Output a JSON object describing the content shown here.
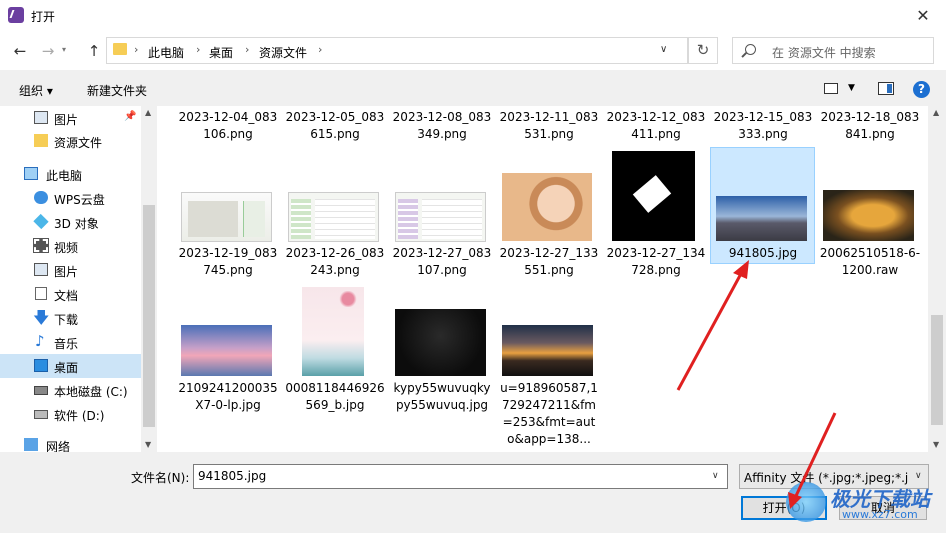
{
  "window": {
    "title": "打开",
    "close_symbol": "✕"
  },
  "nav": {
    "back_symbol": "←",
    "forward_symbol": "→",
    "up_symbol": "↑",
    "breadcrumbs": [
      "此电脑",
      "桌面",
      "资源文件"
    ],
    "search_placeholder": "在 资源文件 中搜索"
  },
  "toolbar": {
    "organize": "组织 ▾",
    "new_folder": "新建文件夹",
    "help": "?"
  },
  "sidebar": {
    "items": [
      {
        "label": "图片",
        "icon": "picture-icon"
      },
      {
        "label": "资源文件",
        "icon": "folder-icon"
      },
      {
        "label": "此电脑",
        "icon": "computer-icon"
      },
      {
        "label": "WPS云盘",
        "icon": "cloud-icon"
      },
      {
        "label": "3D 对象",
        "icon": "cube-icon"
      },
      {
        "label": "视频",
        "icon": "video-icon"
      },
      {
        "label": "图片",
        "icon": "picture-icon"
      },
      {
        "label": "文档",
        "icon": "document-icon"
      },
      {
        "label": "下载",
        "icon": "download-icon"
      },
      {
        "label": "音乐",
        "icon": "music-icon"
      },
      {
        "label": "桌面",
        "icon": "desktop-icon"
      },
      {
        "label": "本地磁盘 (C:)",
        "icon": "drive-icon"
      },
      {
        "label": "软件 (D:)",
        "icon": "drive-icon"
      },
      {
        "label": "网络",
        "icon": "network-icon"
      }
    ]
  },
  "files": {
    "row0": [
      {
        "l1": "2023-12-04_083",
        "l2": "106.png"
      },
      {
        "l1": "2023-12-05_083",
        "l2": "615.png"
      },
      {
        "l1": "2023-12-08_083",
        "l2": "349.png"
      },
      {
        "l1": "2023-12-11_083",
        "l2": "531.png"
      },
      {
        "l1": "2023-12-12_083",
        "l2": "411.png"
      },
      {
        "l1": "2023-12-15_083",
        "l2": "333.png"
      },
      {
        "l1": "2023-12-18_083",
        "l2": "841.png"
      }
    ],
    "row1": [
      {
        "l1": "2023-12-19_083",
        "l2": "745.png"
      },
      {
        "l1": "2023-12-26_083",
        "l2": "243.png"
      },
      {
        "l1": "2023-12-27_083",
        "l2": "107.png"
      },
      {
        "l1": "2023-12-27_133",
        "l2": "551.png"
      },
      {
        "l1": "2023-12-27_134",
        "l2": "728.png"
      },
      {
        "l1": "941805.jpg",
        "l2": ""
      },
      {
        "l1": "20062510518-6-",
        "l2": "1200.raw"
      }
    ],
    "row2": [
      {
        "l1": "2109241200035",
        "l2": "X7-0-lp.jpg"
      },
      {
        "l1": "0008118446926",
        "l2": "569_b.jpg"
      },
      {
        "l1": "kypy55wuvuqky",
        "l2": "py55wuvuq.jpg"
      },
      {
        "l1": "u=918960587,1",
        "l2": "729247211&fm",
        "l3": "=253&fmt=aut",
        "l4": "o&app=138..."
      }
    ]
  },
  "bottom": {
    "filename_label": "文件名(N):",
    "filename_value": "941805.jpg",
    "filetype_value": "Affinity 文件 (*.jpg;*.jpeg;*.jpe",
    "open_button": "打开(O)",
    "cancel_button": "取消"
  },
  "watermark": {
    "text": "极光下载站",
    "url": "www.xz7.com"
  },
  "colors": {
    "selection": "#cce8ff",
    "accent": "#0078d7",
    "arrow": "#e02020"
  }
}
